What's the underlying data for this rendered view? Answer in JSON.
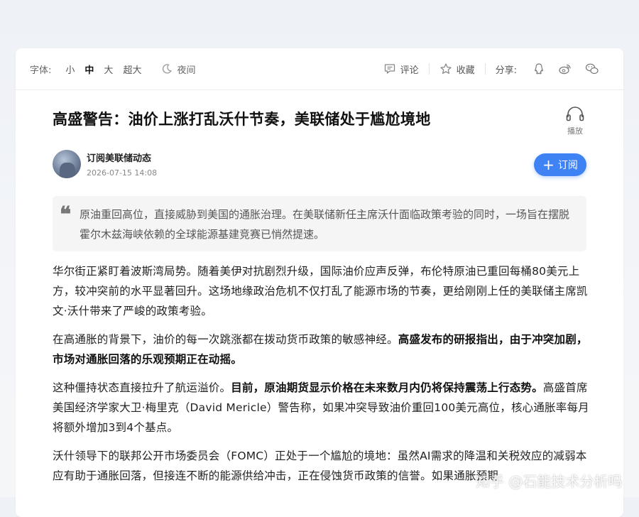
{
  "toolbar": {
    "font_label": "字体:",
    "sizes": [
      "小",
      "中",
      "大",
      "超大"
    ],
    "active_size": "中",
    "night": "夜间",
    "comment": "评论",
    "favorite": "收藏",
    "share": "分享:"
  },
  "article": {
    "title": "高盛警告：油价上涨打乱沃什节奏，美联储处于尴尬境地",
    "play_label": "播放",
    "author_name": "订阅美联储动态",
    "date": "2026-07-15 14:08",
    "subscribe": "订阅",
    "summary": "原油重回高位，直接威胁到美国的通胀治理。在美联储新任主席沃什面临政策考验的同时，一场旨在摆脱霍尔木兹海峡依赖的全球能源基建竞赛已悄然提速。",
    "p1": "华尔街正紧盯着波斯湾局势。随着美伊对抗剧烈升级，国际油价应声反弹，布伦特原油已重回每桶80美元上方，较冲突前的水平显著回升。这场地缘政治危机不仅打乱了能源市场的节奏，更给刚刚上任的美联储主席凯文·沃什带来了严峻的政策考验。",
    "p2_a": "在高通胀的背景下，油价的每一次跳涨都在拨动货币政策的敏感神经。",
    "p2_b": "高盛发布的研报指出，由于冲突加剧，市场对通胀回落的乐观预期正在动摇。",
    "p3_a": "这种僵持状态直接拉升了航运溢价。",
    "p3_b": "目前，原油期货显示价格在未来数月内仍将保持震荡上行态势。",
    "p3_c": "高盛首席美国经济学家大卫·梅里克（David Mericle）警告称，如果冲突导致油价重回100美元高位，核心通胀率每月将额外增加3到4个基点。",
    "p4": "沃什领导下的联邦公开市场委员会（FOMC）正处于一个尴尬的境地：虽然AI需求的降温和关税效应的减弱本应有助于通胀回落，但接连不断的能源供给冲击，正在侵蚀货币政策的信誉。如果通胀预期"
  },
  "watermark": "知乎 @石能技术分析吗",
  "colors": {
    "accent": "#3f82f4",
    "summary_bg": "#f5f5f6"
  }
}
